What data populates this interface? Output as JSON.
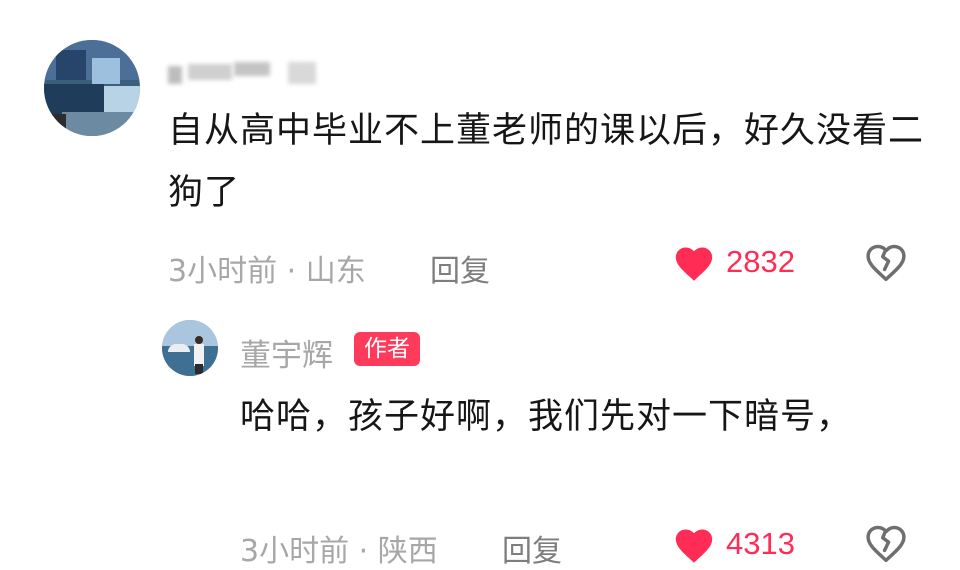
{
  "comment": {
    "text": "自从高中毕业不上董老师的课以后，好久没看二狗了",
    "time_location": "3小时前 · 山东",
    "reply_label": "回复",
    "like_count": "2832",
    "avatar_icon": "blurred-avatar",
    "like_icon": "heart-icon",
    "dislike_icon": "broken-heart-icon"
  },
  "reply": {
    "author_name": "董宇辉",
    "author_badge": "作者",
    "text": "哈哈，孩子好啊，我们先对一下暗号，",
    "time_location": "3小时前 · 陕西",
    "reply_label": "回复",
    "like_count": "4313"
  },
  "colors": {
    "accent": "#ff2d55",
    "badge": "#ff3b5c",
    "meta": "#a7a7a7"
  }
}
